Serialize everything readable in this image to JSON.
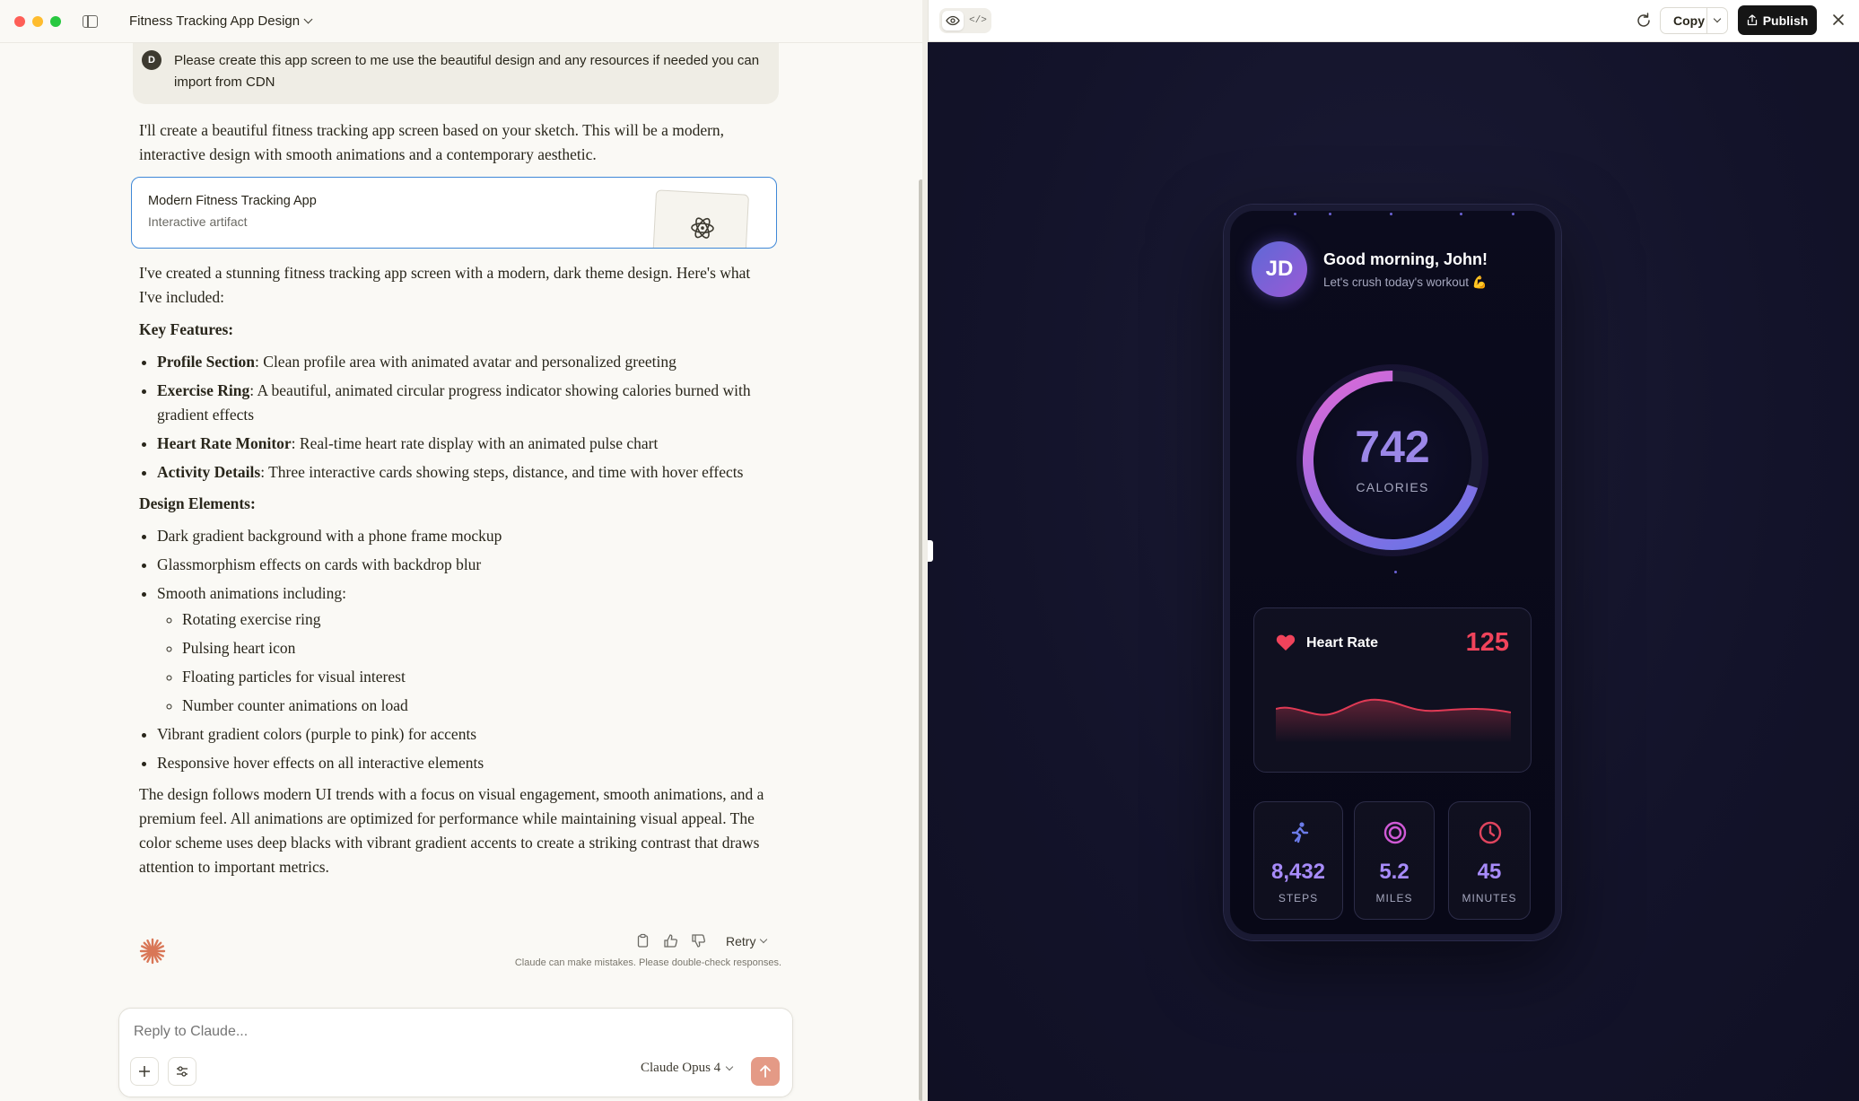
{
  "chat": {
    "title": "Fitness Tracking App Design",
    "user_initial": "D",
    "user_message": "Please create this app screen to me use the beautiful design and any resources if needed you can import from CDN",
    "intro": "I'll create a beautiful fitness tracking app screen based on your sketch. This will be a modern, interactive design with smooth animations and a contemporary aesthetic.",
    "artifact": {
      "title": "Modern Fitness Tracking App",
      "subtitle": "Interactive artifact"
    },
    "summary": "I've created a stunning fitness tracking app screen with a modern, dark theme design. Here's what I've included:",
    "key_features_heading": "Key Features:",
    "key_features": [
      {
        "bold": "Profile Section",
        "text": ": Clean profile area with animated avatar and personalized greeting"
      },
      {
        "bold": "Exercise Ring",
        "text": ": A beautiful, animated circular progress indicator showing calories burned with gradient effects"
      },
      {
        "bold": "Heart Rate Monitor",
        "text": ": Real-time heart rate display with an animated pulse chart"
      },
      {
        "bold": "Activity Details",
        "text": ": Three interactive cards showing steps, distance, and time with hover effects"
      }
    ],
    "design_heading": "Design Elements:",
    "design_items": [
      "Dark gradient background with a phone frame mockup",
      "Glassmorphism effects on cards with backdrop blur",
      "Smooth animations including:"
    ],
    "animation_items": [
      "Rotating exercise ring",
      "Pulsing heart icon",
      "Floating particles for visual interest",
      "Number counter animations on load"
    ],
    "design_items_after": [
      "Vibrant gradient colors (purple to pink) for accents",
      "Responsive hover effects on all interactive elements"
    ],
    "closing": "The design follows modern UI trends with a focus on visual engagement, smooth animations, and a premium feel. All animations are optimized for performance while maintaining visual appeal. The color scheme uses deep blacks with vibrant gradient accents to create a striking contrast that draws attention to important metrics.",
    "retry_label": "Retry",
    "disclaimer": "Claude can make mistakes. Please double-check responses.",
    "composer_placeholder": "Reply to Claude...",
    "model_label": "Claude Opus 4"
  },
  "preview_bar": {
    "copy_label": "Copy",
    "publish_label": "Publish",
    "code_glyph": "</>"
  },
  "app": {
    "avatar_initials": "JD",
    "greeting": "Good morning, John!",
    "sub_greeting": "Let's crush today's workout 💪",
    "calories_value": "742",
    "calories_label": "CALORIES",
    "calories_progress": 0.7,
    "heart_rate_title": "Heart Rate",
    "heart_rate_value": "125",
    "stats": [
      {
        "icon": "running-icon",
        "value": "8,432",
        "label": "STEPS"
      },
      {
        "icon": "target-icon",
        "value": "5.2",
        "label": "MILES"
      },
      {
        "icon": "clock-icon",
        "value": "45",
        "label": "MINUTES"
      }
    ]
  },
  "colors": {
    "accent_purple": "#9b87e8",
    "accent_pink": "#e26ad6",
    "heart_red": "#f0435b",
    "app_bg": "#14142a"
  }
}
